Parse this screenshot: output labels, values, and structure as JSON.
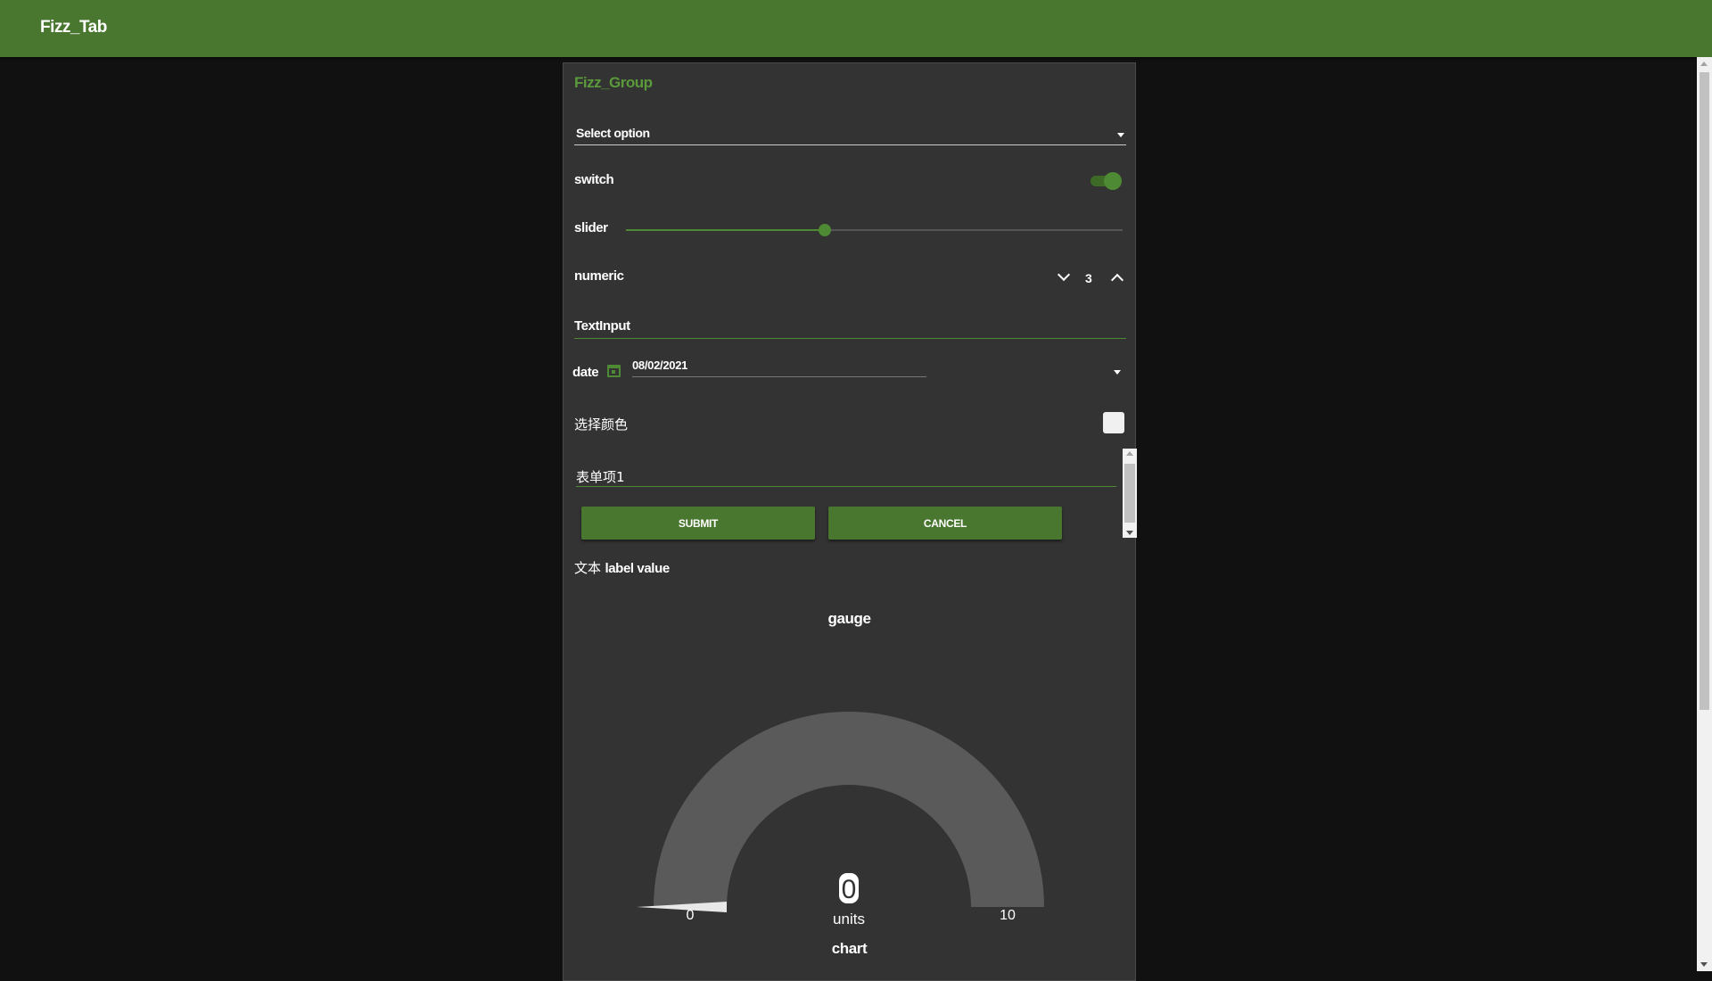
{
  "app": {
    "tab_title": "Fizz_Tab"
  },
  "group": {
    "title": "Fizz_Group"
  },
  "dropdown": {
    "value": "Select option"
  },
  "switch": {
    "label": "switch",
    "on": true
  },
  "slider": {
    "label": "slider",
    "value_fraction": 0.4
  },
  "numeric": {
    "label": "numeric",
    "value": "3"
  },
  "text_input": {
    "label": "TextInput"
  },
  "date_picker": {
    "label": "date",
    "value": "08/02/2021"
  },
  "color_picker": {
    "label": "选择颜色",
    "color": "#f0f0f0"
  },
  "form": {
    "field_label": "表单项1",
    "submit_label": "SUBMIT",
    "cancel_label": "CANCEL"
  },
  "text_widget": {
    "label": "文本",
    "value": "label value"
  },
  "gauge": {
    "title": "gauge",
    "value": "0",
    "units": "units",
    "min": "0",
    "max": "10"
  },
  "chart": {
    "title": "chart"
  },
  "colors": {
    "accent": "#4a7730",
    "accent_light": "#5a9a3a",
    "card": "#333333",
    "background": "#111111",
    "gauge_arc": "#5a5a5a"
  },
  "icons": {
    "dropdown": "caret-down-icon",
    "date": "calendar-icon",
    "numeric_down": "chevron-down-icon",
    "numeric_up": "chevron-up-icon"
  }
}
